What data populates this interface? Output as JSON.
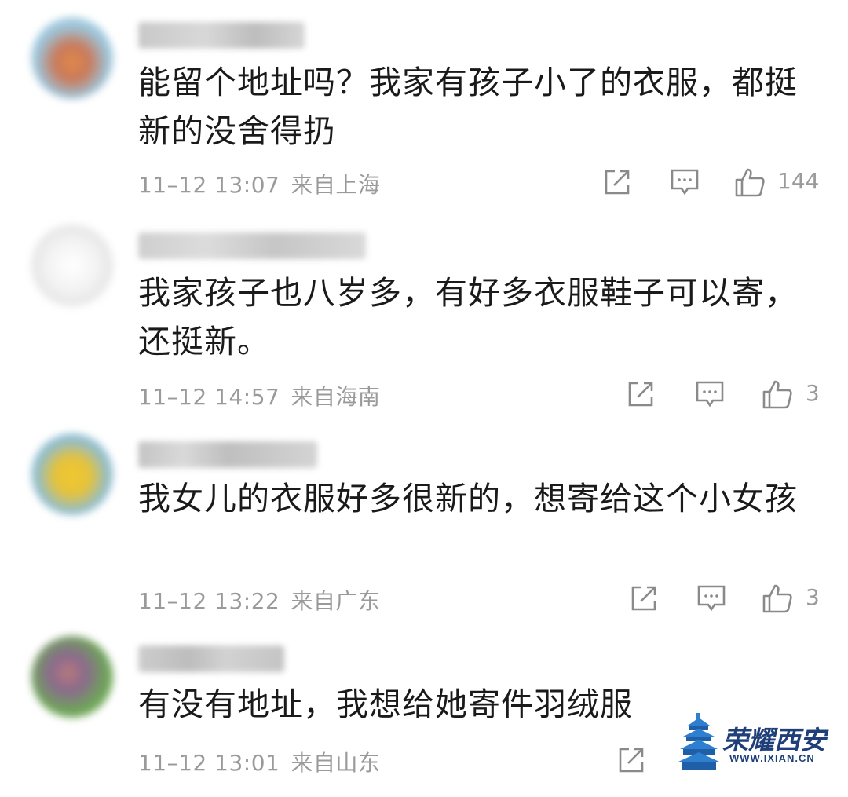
{
  "comments": [
    {
      "text": "能留个地址吗？我家有孩子小了的衣服，都挺新的没舍得扔",
      "timestamp": "11–12 13:07",
      "location": "来自上海",
      "likes": "144"
    },
    {
      "text": "我家孩子也八岁多，有好多衣服鞋子可以寄，还挺新。",
      "timestamp": "11–12 14:57",
      "location": "来自海南",
      "likes": "3"
    },
    {
      "text": "我女儿的衣服好多很新的，想寄给这个小女孩",
      "timestamp": "11–12 13:22",
      "location": "来自广东",
      "likes": "3"
    },
    {
      "text": "有没有地址，我想给她寄件羽绒服",
      "timestamp": "11–12 13:01",
      "location": "来自山东",
      "likes": ""
    }
  ],
  "icons": {
    "share": "share-icon",
    "reply": "reply-icon",
    "like": "thumbs-up-icon"
  },
  "watermark": {
    "title": "荣耀西安",
    "url": "WWW.IXIAN.CN"
  },
  "colors": {
    "text": "#1a1a1a",
    "meta": "#9a9a9a",
    "icon": "#8a8a8a",
    "watermark": "#1f3f7a"
  }
}
